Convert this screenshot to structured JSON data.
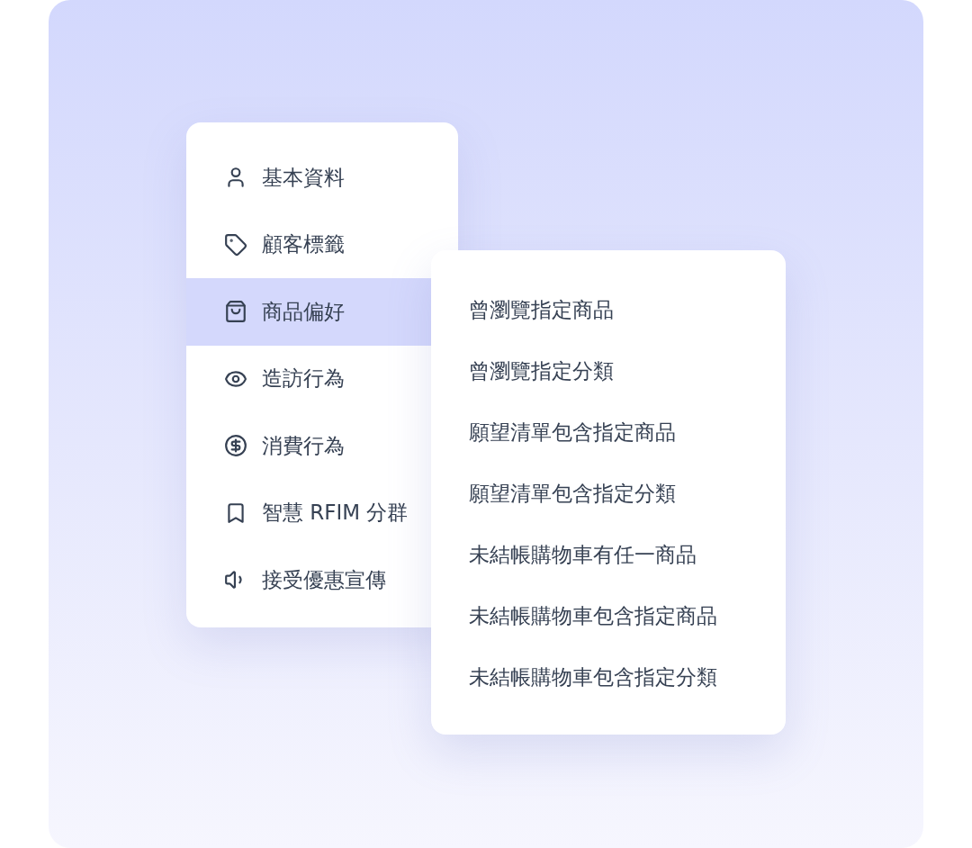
{
  "menu": {
    "items": [
      {
        "label": "基本資料",
        "selected": false
      },
      {
        "label": "顧客標籤",
        "selected": false
      },
      {
        "label": "商品偏好",
        "selected": true
      },
      {
        "label": "造訪行為",
        "selected": false
      },
      {
        "label": "消費行為",
        "selected": false
      },
      {
        "label": "智慧 RFIM 分群",
        "selected": false
      },
      {
        "label": "接受優惠宣傳",
        "selected": false
      }
    ]
  },
  "submenu": {
    "items": [
      "曾瀏覽指定商品",
      "曾瀏覽指定分類",
      "願望清單包含指定商品",
      "願望清單包含指定分類",
      "未結帳購物車有任一商品",
      "未結帳購物車包含指定商品",
      "未結帳購物車包含指定分類"
    ]
  }
}
